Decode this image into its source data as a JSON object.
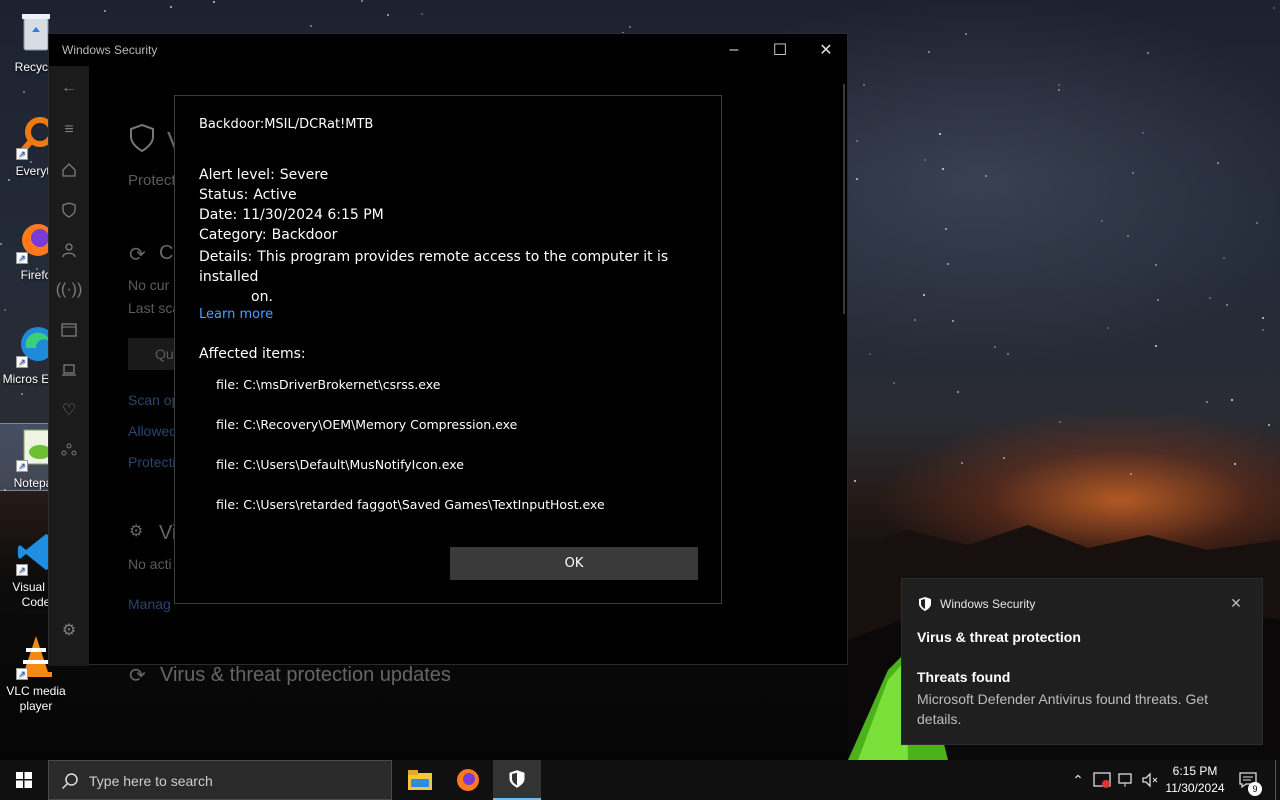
{
  "desktop": {
    "icons": [
      {
        "label": "Recycle",
        "icon": "recycle-bin-icon"
      },
      {
        "label": "Everyth",
        "icon": "everything-search-icon"
      },
      {
        "label": "Firefo",
        "icon": "firefox-icon"
      },
      {
        "label": "Micros Edge",
        "icon": "edge-icon"
      },
      {
        "label": "Notepac",
        "icon": "notepad-plus-plus-icon"
      },
      {
        "label": "Visual St Code",
        "icon": "vscode-icon"
      },
      {
        "label": "VLC media player",
        "icon": "vlc-icon"
      }
    ]
  },
  "window": {
    "title": "Windows Security",
    "controls": {
      "minimize": "–",
      "maximize": "☐",
      "close": "✕"
    }
  },
  "background_page": {
    "heading_initial": "V",
    "protect_text": "Protect",
    "current_threats_title": "Cu",
    "no_current": "No cur",
    "last_scan": "Last sca",
    "quick_button": "Qui",
    "scan_options": "Scan op",
    "allowed": "Allowed",
    "protection_history": "Protecti",
    "settings_title": "Vi",
    "no_action": "No acti",
    "manage": "Manag",
    "updates_title": "Virus & threat protection updates"
  },
  "alert": {
    "threat_name": "Backdoor:MSIL/DCRat!MTB",
    "alert_level_label": "Alert level:",
    "alert_level": "Severe",
    "status_label": "Status:",
    "status": "Active",
    "date_label": "Date:",
    "date": "11/30/2024 6:15 PM",
    "category_label": "Category:",
    "category": "Backdoor",
    "details_label": "Details:",
    "details_line1": "This program provides remote access to the computer it is installed",
    "details_line2": "on.",
    "learn_more": "Learn more",
    "affected_label": "Affected items:",
    "affected_items": [
      "file: C:\\msDriverBrokernet\\csrss.exe",
      "file: C:\\Recovery\\OEM\\Memory Compression.exe",
      "file: C:\\Users\\Default\\MusNotifyIcon.exe",
      "file: C:\\Users\\retarded faggot\\Saved Games\\TextInputHost.exe"
    ],
    "ok_label": "OK"
  },
  "toast": {
    "app_name": "Windows Security",
    "title": "Virus & threat protection",
    "subtitle": "Threats found",
    "body": "Microsoft Defender Antivirus found threats. Get details."
  },
  "taskbar": {
    "search_placeholder": "Type here to search",
    "time": "6:15 PM",
    "date": "11/30/2024",
    "notification_count": "9"
  },
  "colors": {
    "accent_link": "#4aa0ff",
    "dialog_bg": "#000000",
    "toast_bg": "#1f1f1f",
    "taskbar_bg": "#101010"
  }
}
